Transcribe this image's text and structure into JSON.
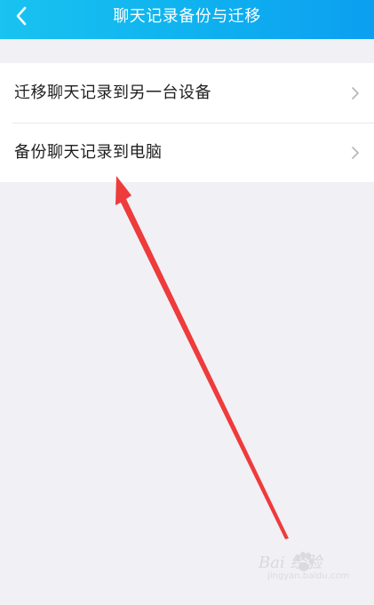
{
  "header": {
    "title": "聊天记录备份与迁移",
    "background_start": "#19c3f0",
    "background_end": "#0c9ff0",
    "back_icon": "chevron-left-icon"
  },
  "list": {
    "items": [
      {
        "label": "迁移聊天记录到另一台设备",
        "icon": "chevron-right-icon"
      },
      {
        "label": "备份聊天记录到电脑",
        "icon": "chevron-right-icon"
      }
    ]
  },
  "annotation": {
    "arrow_color": "#ee3b3b"
  },
  "watermark": {
    "brand": "Bai  经验",
    "sub": "jingyan.baidu.com"
  }
}
